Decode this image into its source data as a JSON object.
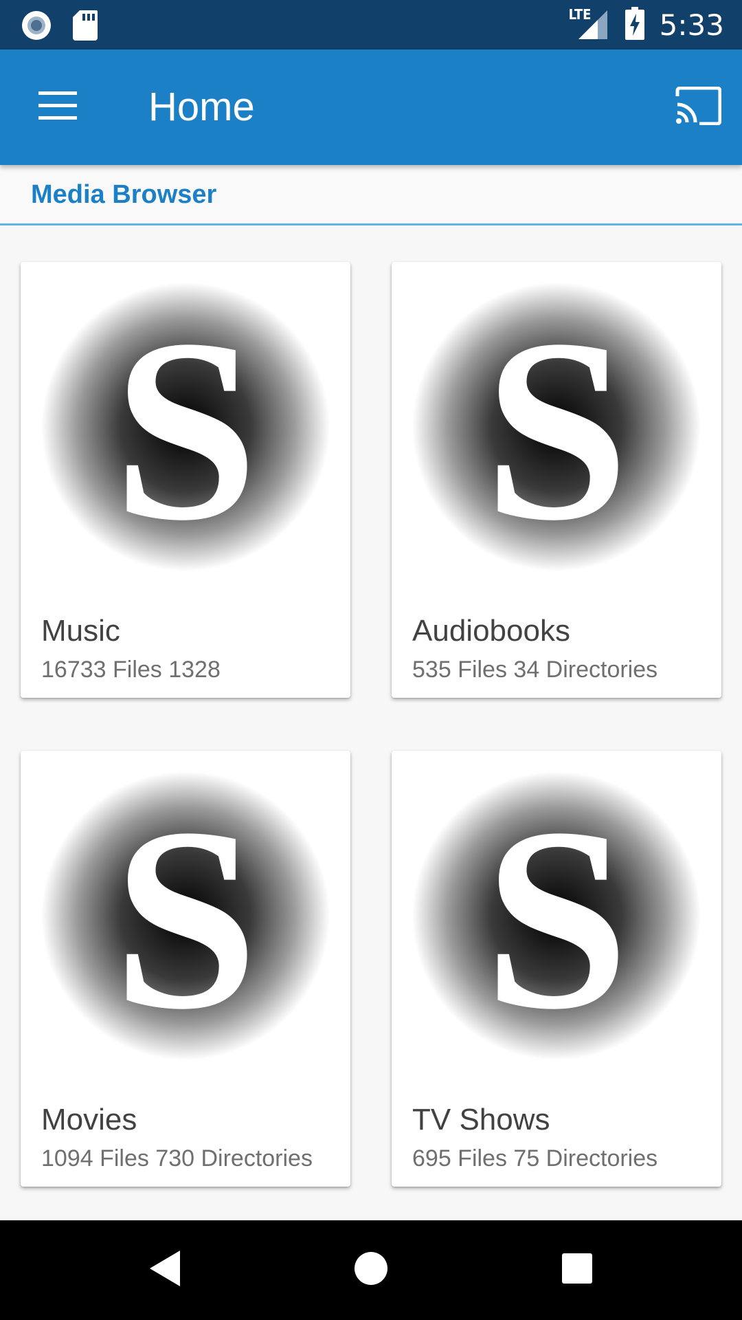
{
  "status_bar": {
    "time": "5:33",
    "network": "LTE",
    "icons": [
      "circle-notification-icon",
      "sd-card-icon",
      "signal-icon",
      "battery-charging-icon"
    ]
  },
  "app_bar": {
    "title": "Home",
    "background": "#1b80c6",
    "icons": [
      "menu-icon",
      "cast-icon"
    ]
  },
  "section": {
    "title": "Media Browser",
    "accent": "#1b80c6"
  },
  "cards": [
    {
      "title": "Music",
      "subtitle": "16733 Files 1328",
      "logo_letter": "S"
    },
    {
      "title": "Audiobooks",
      "subtitle": "535 Files 34 Directories",
      "logo_letter": "S"
    },
    {
      "title": "Movies",
      "subtitle": "1094 Files 730 Directories",
      "logo_letter": "S"
    },
    {
      "title": "TV Shows",
      "subtitle": "695 Files 75 Directories",
      "logo_letter": "S"
    }
  ],
  "nav_bar": {
    "icons": [
      "back-icon",
      "home-icon",
      "recents-icon"
    ]
  }
}
